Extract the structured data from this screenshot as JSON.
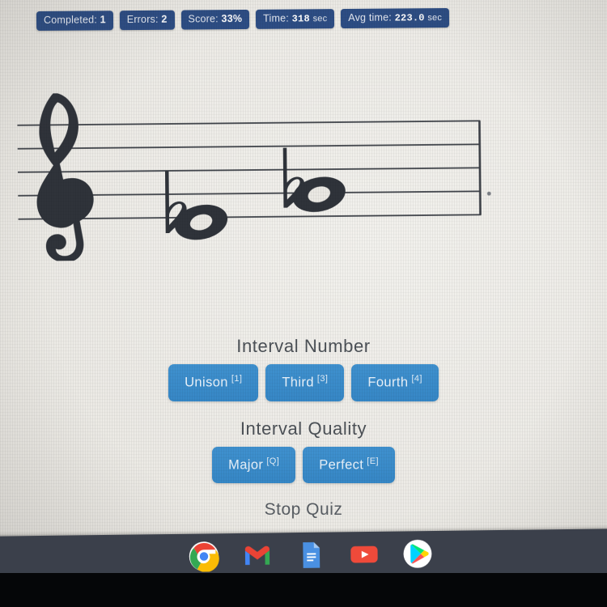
{
  "stats": [
    {
      "name": "completed",
      "label": "Completed:",
      "value": "1",
      "unit": ""
    },
    {
      "name": "errors",
      "label": "Errors:",
      "value": "2",
      "unit": ""
    },
    {
      "name": "score",
      "label": "Score:",
      "value": "33%",
      "unit": ""
    },
    {
      "name": "time",
      "label": "Time:",
      "value": "318",
      "unit": "sec"
    },
    {
      "name": "avg-time",
      "label": "Avg time:",
      "value": "223.0",
      "unit": "sec"
    }
  ],
  "notation": {
    "clef": "treble-clef",
    "notes": [
      {
        "name": "first-note",
        "accidental": "flat",
        "notehead": "whole-note"
      },
      {
        "name": "second-note",
        "accidental": "flat",
        "notehead": "whole-note"
      }
    ],
    "staff_lines": 5
  },
  "quiz": {
    "interval_number": {
      "title": "Interval Number",
      "options": [
        {
          "label": "Unison",
          "key": "[1]"
        },
        {
          "label": "Third",
          "key": "[3]"
        },
        {
          "label": "Fourth",
          "key": "[4]"
        }
      ]
    },
    "interval_quality": {
      "title": "Interval Quality",
      "options": [
        {
          "label": "Major",
          "key": "[Q]"
        },
        {
          "label": "Perfect",
          "key": "[E]"
        }
      ]
    },
    "stop_label": "Stop Quiz"
  },
  "shelf": {
    "icons": [
      {
        "name": "chrome-icon",
        "active": true
      },
      {
        "name": "gmail-icon",
        "active": false
      },
      {
        "name": "google-docs-icon",
        "active": false
      },
      {
        "name": "youtube-icon",
        "active": false
      },
      {
        "name": "play-store-icon",
        "active": false
      }
    ]
  },
  "colors": {
    "badge_bg": "#2d4d84",
    "button_blue": "#3a8ccc",
    "heading": "#4c5157",
    "page_bg": "#ebe9e4",
    "shelf_bg": "#3b404b"
  }
}
